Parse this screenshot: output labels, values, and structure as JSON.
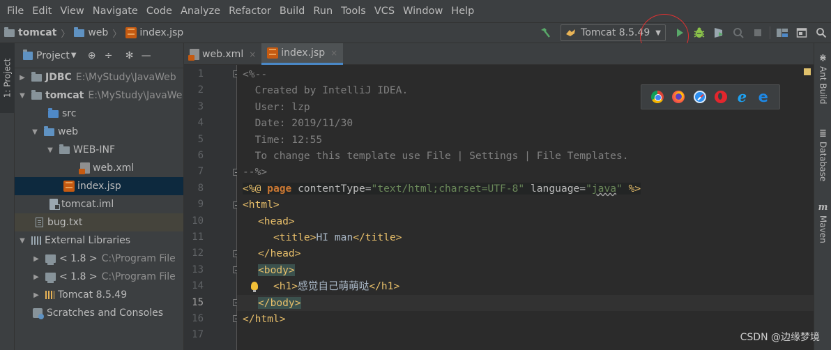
{
  "menu": [
    "File",
    "Edit",
    "View",
    "Navigate",
    "Code",
    "Analyze",
    "Refactor",
    "Build",
    "Run",
    "Tools",
    "VCS",
    "Window",
    "Help"
  ],
  "breadcrumb": [
    "tomcat",
    "web",
    "index.jsp"
  ],
  "run_config": {
    "label": "Tomcat 8.5.49"
  },
  "project_panel": {
    "title": "Project"
  },
  "left_tool_tab": "1: Project",
  "tree": [
    {
      "label": "JDBC",
      "path": "E:\\MyStudy\\JavaWeb"
    },
    {
      "label": "tomcat",
      "path": "E:\\MyStudy\\JavaWe"
    },
    {
      "label": "src"
    },
    {
      "label": "web"
    },
    {
      "label": "WEB-INF"
    },
    {
      "label": "web.xml"
    },
    {
      "label": "index.jsp"
    },
    {
      "label": "tomcat.iml"
    },
    {
      "label": "bug.txt"
    },
    {
      "label": "External Libraries"
    },
    {
      "label": "< 1.8 >",
      "path": "C:\\Program File"
    },
    {
      "label": "< 1.8 >",
      "path": "C:\\Program File"
    },
    {
      "label": "Tomcat 8.5.49"
    },
    {
      "label": "Scratches and Consoles"
    }
  ],
  "editor_tabs": [
    {
      "label": "web.xml",
      "close": "×"
    },
    {
      "label": "index.jsp",
      "close": "×"
    }
  ],
  "line_numbers": [
    "1",
    "2",
    "3",
    "4",
    "5",
    "6",
    "7",
    "8",
    "9",
    "10",
    "11",
    "12",
    "13",
    "14",
    "15",
    "16",
    "17"
  ],
  "code": {
    "l1": "<%--",
    "l2": "  Created by IntelliJ IDEA.",
    "l3": "  User: lzp",
    "l4": "  Date: 2019/11/30",
    "l5": "  Time: 12:55",
    "l6": "  To change this template use File | Settings | File Templates.",
    "l7": "--%>",
    "l8_open": "<%@ ",
    "l8_kw": "page",
    "l8_attr1": " contentType=",
    "l8_val1": "\"text/html;charset=UTF-8\"",
    "l8_attr2": " language=",
    "l8_val2_q1": "\"",
    "l8_val2": "java",
    "l8_val2_q2": "\"",
    "l8_close": " %>",
    "l9": "<html>",
    "l10": "<head>",
    "l11_open": "<title>",
    "l11_text": "HI man",
    "l11_close": "</title>",
    "l12": "</head>",
    "l13": "<body>",
    "l14_open": "<h1>",
    "l14_text": "感觉自己萌萌哒",
    "l14_close": "</h1>",
    "l15": "</body>",
    "l16": "</html>"
  },
  "right_tabs": [
    "Ant Build",
    "Database",
    "Maven"
  ],
  "right_tab_icons": [
    "ant-icon",
    "database-icon",
    "maven-icon"
  ],
  "maven_glyph": "m",
  "watermark": "CSDN @边缘梦境",
  "colors": {
    "background": "#2b2b2b",
    "panel": "#3c3f41",
    "run": "#59a869",
    "debug": "#8bc34a",
    "annotation_circle": "#e03131",
    "selection": "#0d293e"
  }
}
